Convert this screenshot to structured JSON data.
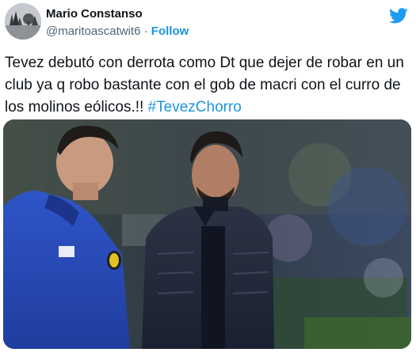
{
  "author": {
    "display_name": "Mario Constanso",
    "handle": "@maritoascatwit6",
    "separator": "·",
    "follow_label": "Follow"
  },
  "tweet": {
    "text": "Tevez debutó con derrota como Dt que dejer de robar en un club ya q robo bastante con el gob de macri con el curro de los molinos eólicos.!! ",
    "hashtag": "#TevezChorro"
  },
  "icons": {
    "brand": "twitter-bird-icon"
  },
  "colors": {
    "link": "#1b95e0",
    "brand": "#1d9bf0",
    "text": "#0f1419",
    "secondary_text": "#536471"
  }
}
